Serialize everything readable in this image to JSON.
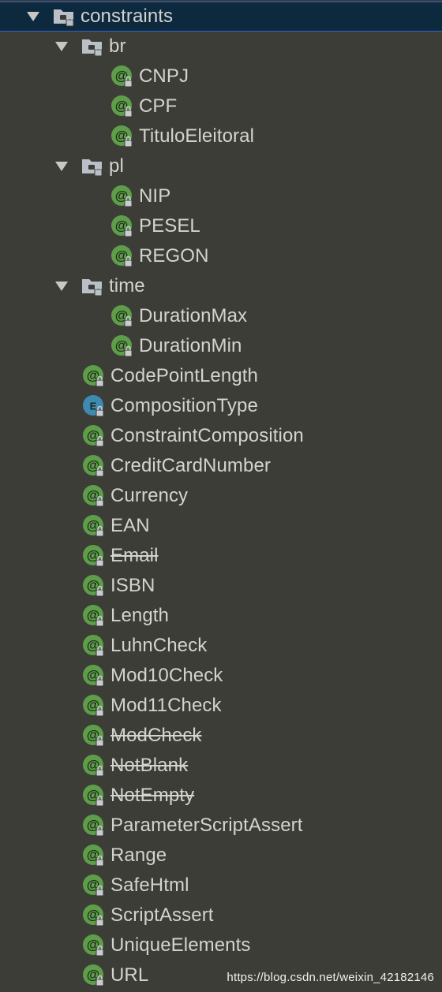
{
  "tree": [
    {
      "label": "constraints",
      "kind": "package",
      "level": 0,
      "expanded": true,
      "selected": true,
      "deprecated": false
    },
    {
      "label": "br",
      "kind": "package",
      "level": 1,
      "expanded": true,
      "selected": false,
      "deprecated": false
    },
    {
      "label": "CNPJ",
      "kind": "annotation",
      "level": 2,
      "selected": false,
      "deprecated": false
    },
    {
      "label": "CPF",
      "kind": "annotation",
      "level": 2,
      "selected": false,
      "deprecated": false
    },
    {
      "label": "TituloEleitoral",
      "kind": "annotation",
      "level": 2,
      "selected": false,
      "deprecated": false
    },
    {
      "label": "pl",
      "kind": "package",
      "level": 1,
      "expanded": true,
      "selected": false,
      "deprecated": false
    },
    {
      "label": "NIP",
      "kind": "annotation",
      "level": 2,
      "selected": false,
      "deprecated": false
    },
    {
      "label": "PESEL",
      "kind": "annotation",
      "level": 2,
      "selected": false,
      "deprecated": false
    },
    {
      "label": "REGON",
      "kind": "annotation",
      "level": 2,
      "selected": false,
      "deprecated": false
    },
    {
      "label": "time",
      "kind": "package",
      "level": 1,
      "expanded": true,
      "selected": false,
      "deprecated": false
    },
    {
      "label": "DurationMax",
      "kind": "annotation",
      "level": 2,
      "selected": false,
      "deprecated": false
    },
    {
      "label": "DurationMin",
      "kind": "annotation",
      "level": 2,
      "selected": false,
      "deprecated": false
    },
    {
      "label": "CodePointLength",
      "kind": "annotation",
      "level": 1,
      "selected": false,
      "deprecated": false
    },
    {
      "label": "CompositionType",
      "kind": "enum",
      "level": 1,
      "selected": false,
      "deprecated": false
    },
    {
      "label": "ConstraintComposition",
      "kind": "annotation",
      "level": 1,
      "selected": false,
      "deprecated": false
    },
    {
      "label": "CreditCardNumber",
      "kind": "annotation",
      "level": 1,
      "selected": false,
      "deprecated": false
    },
    {
      "label": "Currency",
      "kind": "annotation",
      "level": 1,
      "selected": false,
      "deprecated": false
    },
    {
      "label": "EAN",
      "kind": "annotation",
      "level": 1,
      "selected": false,
      "deprecated": false
    },
    {
      "label": "Email",
      "kind": "annotation",
      "level": 1,
      "selected": false,
      "deprecated": true
    },
    {
      "label": "ISBN",
      "kind": "annotation",
      "level": 1,
      "selected": false,
      "deprecated": false
    },
    {
      "label": "Length",
      "kind": "annotation",
      "level": 1,
      "selected": false,
      "deprecated": false
    },
    {
      "label": "LuhnCheck",
      "kind": "annotation",
      "level": 1,
      "selected": false,
      "deprecated": false
    },
    {
      "label": "Mod10Check",
      "kind": "annotation",
      "level": 1,
      "selected": false,
      "deprecated": false
    },
    {
      "label": "Mod11Check",
      "kind": "annotation",
      "level": 1,
      "selected": false,
      "deprecated": false
    },
    {
      "label": "ModCheck",
      "kind": "annotation",
      "level": 1,
      "selected": false,
      "deprecated": true
    },
    {
      "label": "NotBlank",
      "kind": "annotation",
      "level": 1,
      "selected": false,
      "deprecated": true
    },
    {
      "label": "NotEmpty",
      "kind": "annotation",
      "level": 1,
      "selected": false,
      "deprecated": true
    },
    {
      "label": "ParameterScriptAssert",
      "kind": "annotation",
      "level": 1,
      "selected": false,
      "deprecated": false
    },
    {
      "label": "Range",
      "kind": "annotation",
      "level": 1,
      "selected": false,
      "deprecated": false
    },
    {
      "label": "SafeHtml",
      "kind": "annotation",
      "level": 1,
      "selected": false,
      "deprecated": false
    },
    {
      "label": "ScriptAssert",
      "kind": "annotation",
      "level": 1,
      "selected": false,
      "deprecated": false
    },
    {
      "label": "UniqueElements",
      "kind": "annotation",
      "level": 1,
      "selected": false,
      "deprecated": false
    },
    {
      "label": "URL",
      "kind": "annotation",
      "level": 1,
      "selected": false,
      "deprecated": false
    }
  ],
  "icons": {
    "package": "folder-package-icon",
    "annotation": "annotation-icon",
    "enum": "enum-icon",
    "lock": "lock-icon",
    "arrow": "expand-arrow-icon"
  },
  "colors": {
    "background": "#3d3d38",
    "text": "#d3d3d0",
    "selection": "#0d293e",
    "annotation_badge": "#5e9e4a",
    "enum_badge": "#3f8ab3",
    "folder": "#b9c0c8"
  },
  "watermark": "https://blog.csdn.net/weixin_42182146"
}
